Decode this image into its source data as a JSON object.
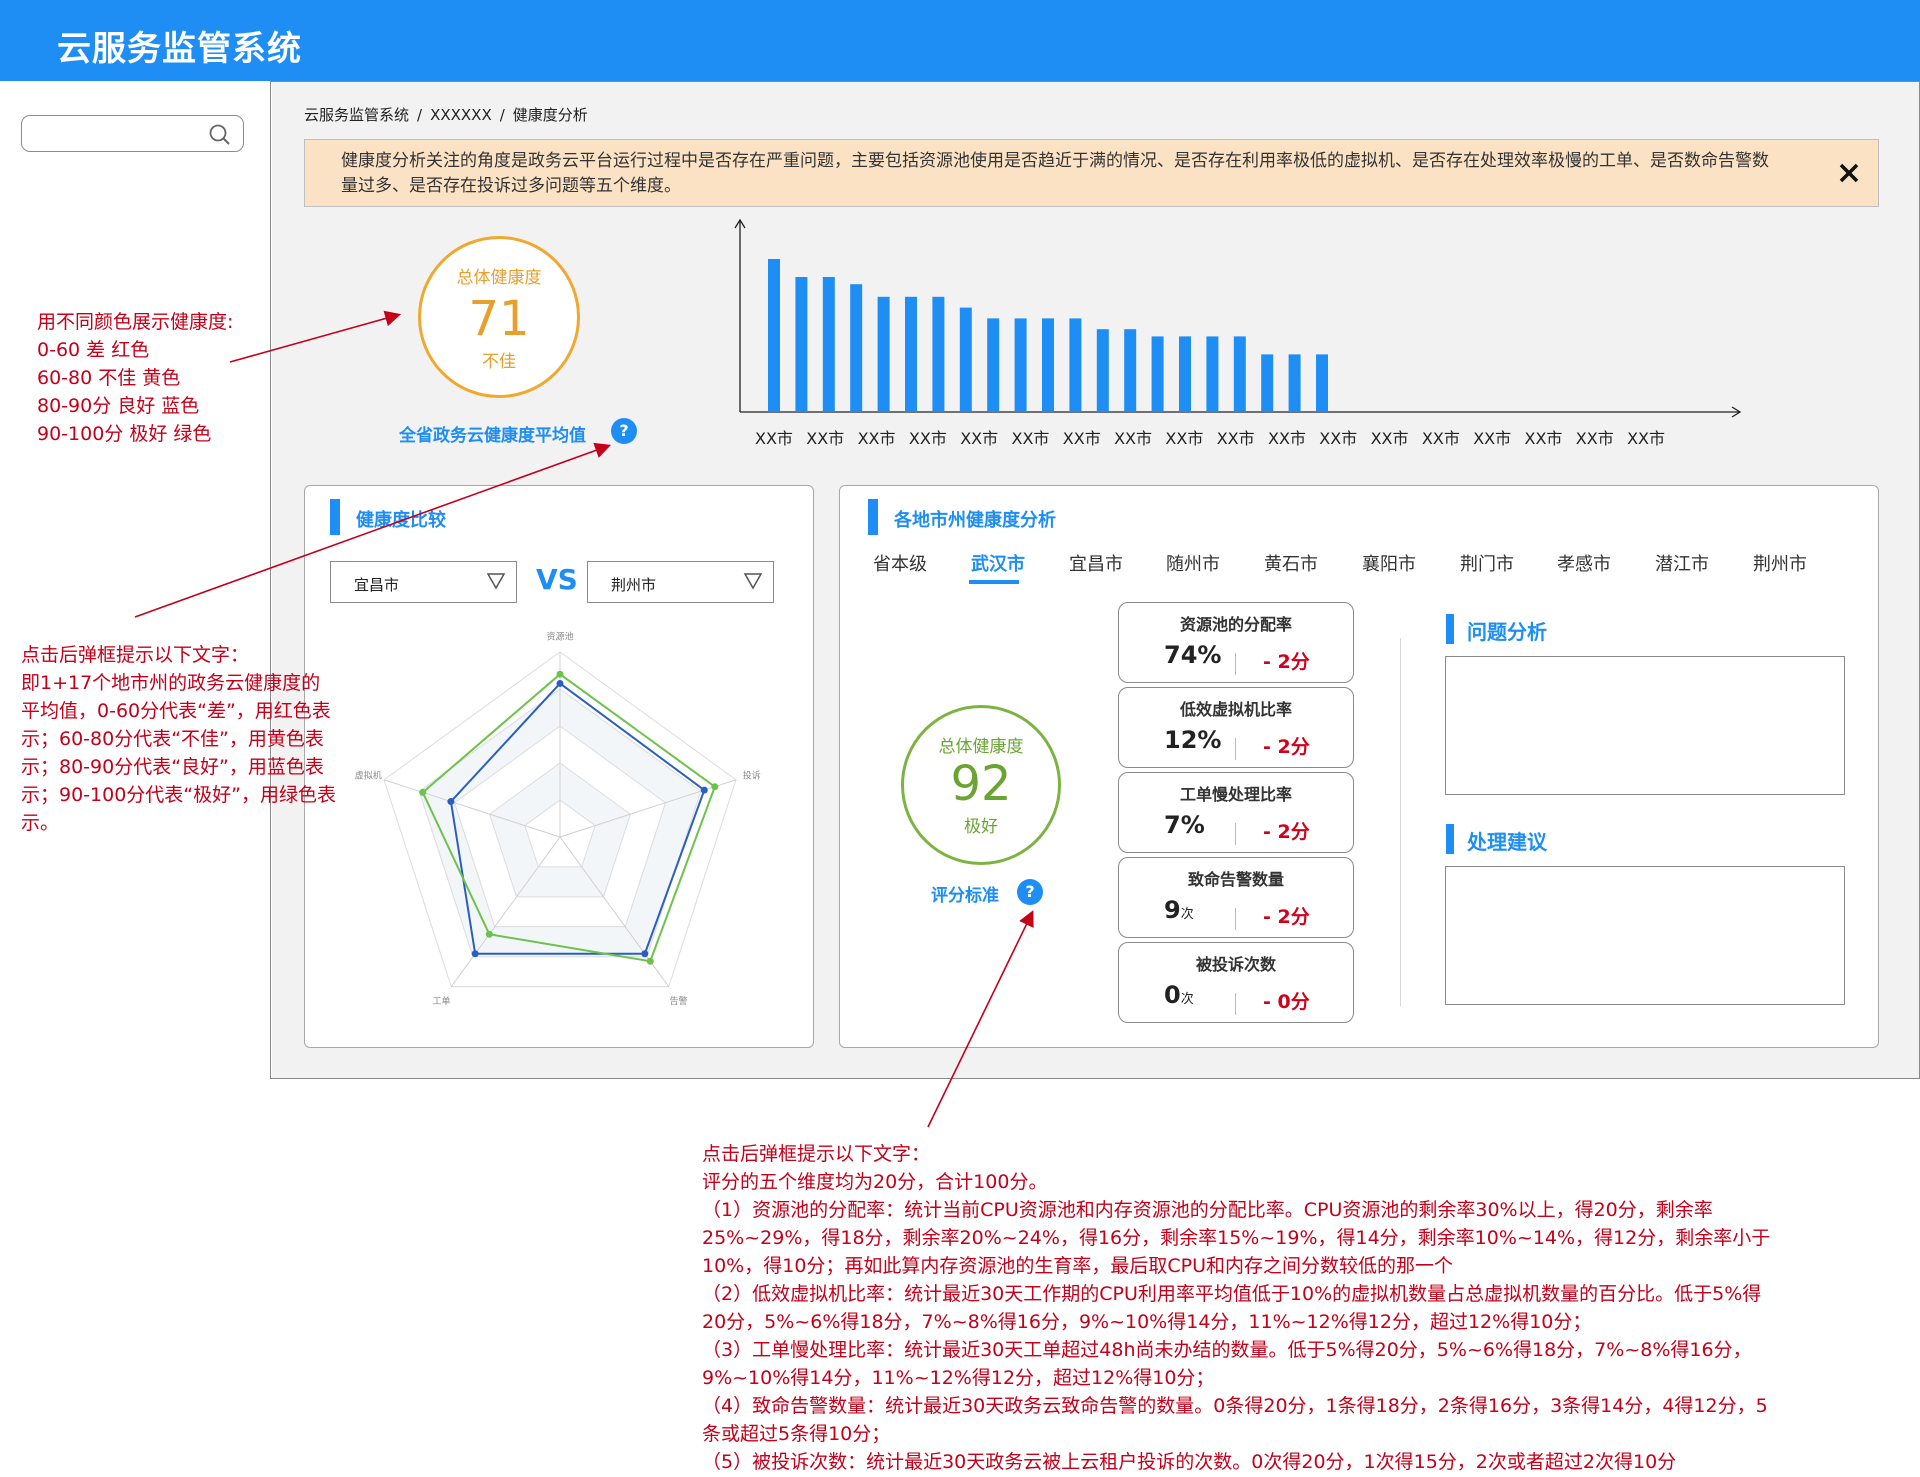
{
  "app": {
    "title": "云服务监管系统"
  },
  "search": {
    "placeholder": ""
  },
  "breadcrumb": [
    "云服务监管系统",
    "XXXXXX",
    "健康度分析"
  ],
  "breadcrumb_sep": "/",
  "notice": {
    "text": "健康度分析关注的角度是政务云平台运行过程中是否存在严重问题，主要包括资源池使用是否趋近于满的情况、是否存在利用率极低的虚拟机、是否存在处理效率极慢的工单、是否数命告警数量过多、是否存在投诉过多问题等五个维度。",
    "close_icon": "close-icon"
  },
  "overall": {
    "title": "总体健康度",
    "score": "71",
    "level": "不佳",
    "color": "#e89f2c"
  },
  "overall_link": "全省政务云健康度平均值",
  "help_glyph": "?",
  "chart_data": {
    "type": "bar",
    "categories": [
      "XX市",
      "XX市",
      "XX市",
      "XX市",
      "XX市",
      "XX市",
      "XX市",
      "XX市",
      "XX市",
      "XX市",
      "XX市",
      "XX市",
      "XX市",
      "XX市",
      "XX市",
      "XX市",
      "XX市",
      "XX市"
    ],
    "values": [
      85,
      75,
      75,
      71,
      64,
      64,
      64,
      58,
      52,
      52,
      52,
      52,
      46,
      46,
      42,
      42,
      42,
      42,
      32,
      32,
      32
    ],
    "bar_color": "#1e8ef5",
    "title": "",
    "xlabel": "",
    "ylabel": ""
  },
  "compare": {
    "title": "健康度比较",
    "left_select": "宜昌市",
    "right_select": "荆州市",
    "vs": "VS",
    "radar": {
      "axes": [
        "资源池",
        "投诉",
        "告警",
        "工单",
        "虚拟机"
      ],
      "series": [
        {
          "color": "#2b5fbf",
          "values": [
            0.83,
            0.82,
            0.78,
            0.78,
            0.62
          ]
        },
        {
          "color": "#6cc24a",
          "values": [
            0.88,
            0.88,
            0.83,
            0.65,
            0.78
          ]
        }
      ]
    }
  },
  "city": {
    "title": "各地市州健康度分析",
    "tabs": [
      "省本级",
      "武汉市",
      "宜昌市",
      "随州市",
      "黄石市",
      "襄阳市",
      "荆门市",
      "孝感市",
      "潜江市",
      "荆州市"
    ],
    "active_tab": 1,
    "overall": {
      "title": "总体健康度",
      "score": "92",
      "level": "极好",
      "color": "#6aa534"
    },
    "std_link": "评分标准",
    "metrics": [
      {
        "label": "资源池的分配率",
        "value": "74%",
        "unit": "",
        "score": "- 2分"
      },
      {
        "label": "低效虚拟机比率",
        "value": "12%",
        "unit": "",
        "score": "- 2分"
      },
      {
        "label": "工单慢处理比率",
        "value": "7%",
        "unit": "",
        "score": "- 2分"
      },
      {
        "label": "致命告警数量",
        "value": "9",
        "unit": "次",
        "score": "- 2分"
      },
      {
        "label": "被投诉次数",
        "value": "0",
        "unit": "次",
        "score": "- 0分"
      }
    ],
    "problem_title": "问题分析",
    "advice_title": "处理建议"
  },
  "annotations": {
    "colors": [
      "用不同颜色展示健康度:",
      "0-60 差  红色",
      "60-80  不佳  黄色",
      "80-90分 良好  蓝色",
      "90-100分 极好   绿色"
    ],
    "avg_popup": "点击后弹框提示以下文字：\n即1+17个地市州的政务云健康度的平均值，0-60分代表“差”，用红色表示；60-80分代表“不佳”，用黄色表示；80-90分代表“良好”，用蓝色表示；90-100分代表“极好”，用绿色表示。",
    "std_popup": [
      "点击后弹框提示以下文字：",
      "评分的五个维度均为20分，合计100分。",
      "（1）资源池的分配率：统计当前CPU资源池和内存资源池的分配比率。CPU资源池的剩余率30%以上，得20分，剩余率25%~29%，得18分，剩余率20%~24%，得16分，剩余率15%~19%，得14分，剩余率10%~14%，得12分，剩余率小于10%，得10分；再如此算内存资源池的生育率，最后取CPU和内存之间分数较低的那一个",
      "（2）低效虚拟机比率：统计最近30天工作期的CPU利用率平均值低于10%的虚拟机数量占总虚拟机数量的百分比。低于5%得20分，5%~6%得18分，7%~8%得16分，9%~10%得14分，11%~12%得12分，超过12%得10分；",
      "（3）工单慢处理比率：统计最近30天工单超过48h尚未办结的数量。低于5%得20分，5%~6%得18分，7%~8%得16分，9%~10%得14分，11%~12%得12分，超过12%得10分；",
      "（4）致命告警数量：统计最近30天政务云致命告警的数量。0条得20分，1条得18分，2条得16分，3条得14分，4得12分，5条或超过5条得10分；",
      "（5）被投诉次数：统计最近30天政务云被上云租户投诉的次数。0次得20分，1次得15分，2次或者超过2次得10分"
    ]
  }
}
